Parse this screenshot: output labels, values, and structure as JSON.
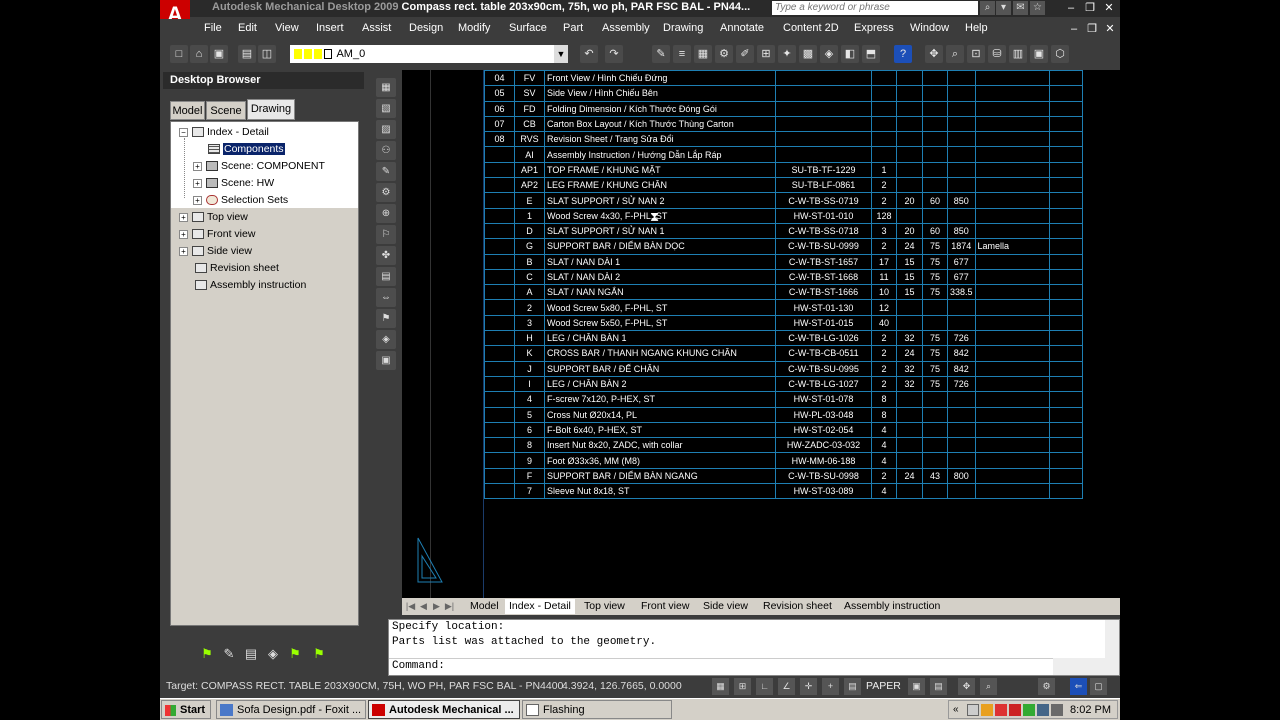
{
  "window": {
    "app_name": "Autodesk Mechanical Desktop 2009",
    "doc_name": "Compass rect. table 203x90cm, 75h, wo ph, PAR FSC BAL - PN44...",
    "search_placeholder": "Type a keyword or phrase"
  },
  "menu": [
    "File",
    "Edit",
    "View",
    "Insert",
    "Assist",
    "Design",
    "Modify",
    "Surface",
    "Part",
    "Assembly",
    "Drawing",
    "Annotate",
    "Content 2D",
    "Express",
    "Window",
    "Help"
  ],
  "toolbar": {
    "layer_name": "AM_0"
  },
  "browser": {
    "title": "Desktop Browser",
    "tabs": [
      "Model",
      "Scene",
      "Drawing"
    ],
    "active_tab": "Drawing",
    "tree": [
      {
        "label": "Index - Detail",
        "expander": "−",
        "icon": "layout"
      },
      {
        "label": "Components",
        "icon": "grid",
        "selected": true
      },
      {
        "label": "Scene: COMPONENT",
        "expander": "+",
        "icon": "scene"
      },
      {
        "label": "Scene: HW",
        "expander": "+",
        "icon": "scene"
      },
      {
        "label": "Selection Sets",
        "expander": "+",
        "icon": "sel"
      },
      {
        "label": "Top view",
        "expander": "+",
        "icon": "layout"
      },
      {
        "label": "Front view",
        "expander": "+",
        "icon": "layout"
      },
      {
        "label": "Side view",
        "expander": "+",
        "icon": "layout"
      },
      {
        "label": "Revision sheet",
        "icon": "layout"
      },
      {
        "label": "Assembly instruction",
        "icon": "layout"
      }
    ]
  },
  "bom": {
    "rows": [
      [
        "04",
        "FV",
        "Front View / Hình Chiếu Đứng",
        "",
        "",
        "",
        "",
        "",
        ""
      ],
      [
        "05",
        "SV",
        "Side View / Hình Chiếu Bên",
        "",
        "",
        "",
        "",
        "",
        ""
      ],
      [
        "06",
        "FD",
        "Folding Dimension / Kích Thước Đóng Gói",
        "",
        "",
        "",
        "",
        "",
        ""
      ],
      [
        "07",
        "CB",
        "Carton Box Layout / Kích Thước Thùng Carton",
        "",
        "",
        "",
        "",
        "",
        ""
      ],
      [
        "08",
        "RVS",
        "Revision Sheet / Trang Sửa Đổi",
        "",
        "",
        "",
        "",
        "",
        ""
      ],
      [
        "",
        "AI",
        "Assembly Instruction / Hướng Dẫn Lắp Ráp",
        "",
        "",
        "",
        "",
        "",
        ""
      ],
      [
        "",
        "AP1",
        "TOP FRAME / KHUNG MẶT",
        "SU-TB-TF-1229",
        "1",
        "",
        "",
        "",
        ""
      ],
      [
        "",
        "AP2",
        "LEG FRAME / KHUNG CHÂN",
        "SU-TB-LF-0861",
        "2",
        "",
        "",
        "",
        ""
      ],
      [
        "",
        "E",
        "SLAT SUPPORT / SỬ NAN 2",
        "C-W-TB-SS-0719",
        "2",
        "20",
        "60",
        "850",
        ""
      ],
      [
        "",
        "1",
        "Wood Screw 4x30, F-PHL, ST",
        "HW-ST-01-010",
        "128",
        "",
        "",
        "",
        ""
      ],
      [
        "",
        "D",
        "SLAT SUPPORT / SỬ NAN 1",
        "C-W-TB-SS-0718",
        "3",
        "20",
        "60",
        "850",
        ""
      ],
      [
        "",
        "G",
        "SUPPORT BAR / DIỂM BÀN DỌC",
        "C-W-TB-SU-0999",
        "2",
        "24",
        "75",
        "1874",
        "Lamella"
      ],
      [
        "",
        "B",
        "SLAT / NAN DÀI 1",
        "C-W-TB-ST-1657",
        "17",
        "15",
        "75",
        "677",
        ""
      ],
      [
        "",
        "C",
        "SLAT / NAN DÀI 2",
        "C-W-TB-ST-1668",
        "11",
        "15",
        "75",
        "677",
        ""
      ],
      [
        "",
        "A",
        "SLAT / NAN NGẮN",
        "C-W-TB-ST-1666",
        "10",
        "15",
        "75",
        "338.5",
        ""
      ],
      [
        "",
        "2",
        "Wood Screw 5x80, F-PHL, ST",
        "HW-ST-01-130",
        "12",
        "",
        "",
        "",
        ""
      ],
      [
        "",
        "3",
        "Wood Screw 5x50, F-PHL, ST",
        "HW-ST-01-015",
        "40",
        "",
        "",
        "",
        ""
      ],
      [
        "",
        "H",
        "LEG / CHÂN BÀN 1",
        "C-W-TB-LG-1026",
        "2",
        "32",
        "75",
        "726",
        ""
      ],
      [
        "",
        "K",
        "CROSS BAR / THANH NGANG KHUNG CHÂN",
        "C-W-TB-CB-0511",
        "2",
        "24",
        "75",
        "842",
        ""
      ],
      [
        "",
        "J",
        "SUPPORT BAR / ĐẾ CHÂN",
        "C-W-TB-SU-0995",
        "2",
        "32",
        "75",
        "842",
        ""
      ],
      [
        "",
        "I",
        "LEG / CHÂN BÀN 2",
        "C-W-TB-LG-1027",
        "2",
        "32",
        "75",
        "726",
        ""
      ],
      [
        "",
        "4",
        "F-screw 7x120, P-HEX, ST",
        "HW-ST-01-078",
        "8",
        "",
        "",
        "",
        ""
      ],
      [
        "",
        "5",
        "Cross Nut Ø20x14, PL",
        "HW-PL-03-048",
        "8",
        "",
        "",
        "",
        ""
      ],
      [
        "",
        "6",
        "F-Bolt 6x40, P-HEX, ST",
        "HW-ST-02-054",
        "4",
        "",
        "",
        "",
        ""
      ],
      [
        "",
        "8",
        "Insert Nut 8x20, ZADC, with collar",
        "HW-ZADC-03-032",
        "4",
        "",
        "",
        "",
        ""
      ],
      [
        "",
        "9",
        "Foot Ø33x36, MM (M8)",
        "HW-MM-06-188",
        "4",
        "",
        "",
        "",
        ""
      ],
      [
        "",
        "F",
        "SUPPORT BAR / DIỂM BÀN NGANG",
        "C-W-TB-SU-0998",
        "2",
        "24",
        "43",
        "800",
        ""
      ],
      [
        "",
        "7",
        "Sleeve Nut 8x18, ST",
        "HW-ST-03-089",
        "4",
        "",
        "",
        "",
        ""
      ]
    ]
  },
  "layout_tabs": [
    "Model",
    "Index - Detail",
    "Top view",
    "Front view",
    "Side view",
    "Revision sheet",
    "Assembly instruction"
  ],
  "active_layout": "Index - Detail",
  "command": {
    "line1": "Specify location:",
    "line2": "Parts list was attached to the geometry.",
    "prompt": "Command:"
  },
  "status": {
    "target": "Target: COMPASS RECT. TABLE 203X90CM, 75H, WO PH, PAR FSC BAL - PN4400",
    "coords": "4.3924, 126.7665, 0.0000",
    "space": "PAPER"
  },
  "taskbar": {
    "start": "Start",
    "tasks": [
      "Sofa Design.pdf - Foxit ...",
      "Autodesk Mechanical ...",
      "Flashing"
    ],
    "active_task": 1,
    "clock": "8:02 PM"
  }
}
